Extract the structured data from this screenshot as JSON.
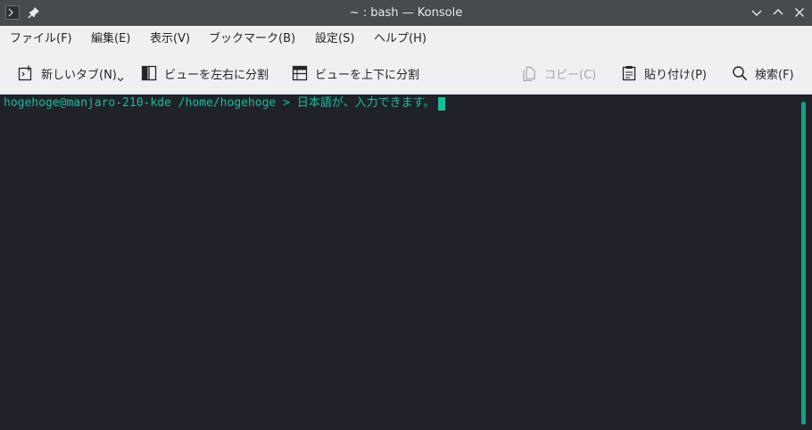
{
  "window": {
    "title": "~ : bash — Konsole",
    "icons": {
      "app": "terminal-app-icon",
      "pin": "pin-icon",
      "minimize": "chevron-down-icon",
      "maximize": "chevron-up-icon",
      "close": "close-icon"
    }
  },
  "menubar": {
    "items": [
      {
        "label": "ファイル(F)"
      },
      {
        "label": "編集(E)"
      },
      {
        "label": "表示(V)"
      },
      {
        "label": "ブックマーク(B)"
      },
      {
        "label": "設定(S)"
      },
      {
        "label": "ヘルプ(H)"
      }
    ]
  },
  "toolbar": {
    "new_tab": {
      "label": "新しいタブ(N)",
      "icon": "new-tab-icon"
    },
    "split_lr": {
      "label": "ビューを左右に分割",
      "icon": "split-left-right-icon"
    },
    "split_tb": {
      "label": "ビューを上下に分割",
      "icon": "split-top-bottom-icon"
    },
    "copy": {
      "label": "コピー(C)",
      "icon": "copy-icon",
      "enabled": false
    },
    "paste": {
      "label": "貼り付け(P)",
      "icon": "paste-icon"
    },
    "find": {
      "label": "検索(F)",
      "icon": "search-icon"
    }
  },
  "terminal": {
    "prompt": "hogehoge@manjaro-210-kde /home/hogehoge >",
    "input": "日本語が、入力できます。",
    "colors": {
      "background": "#1f2229",
      "foreground": "#1abc9c"
    }
  }
}
